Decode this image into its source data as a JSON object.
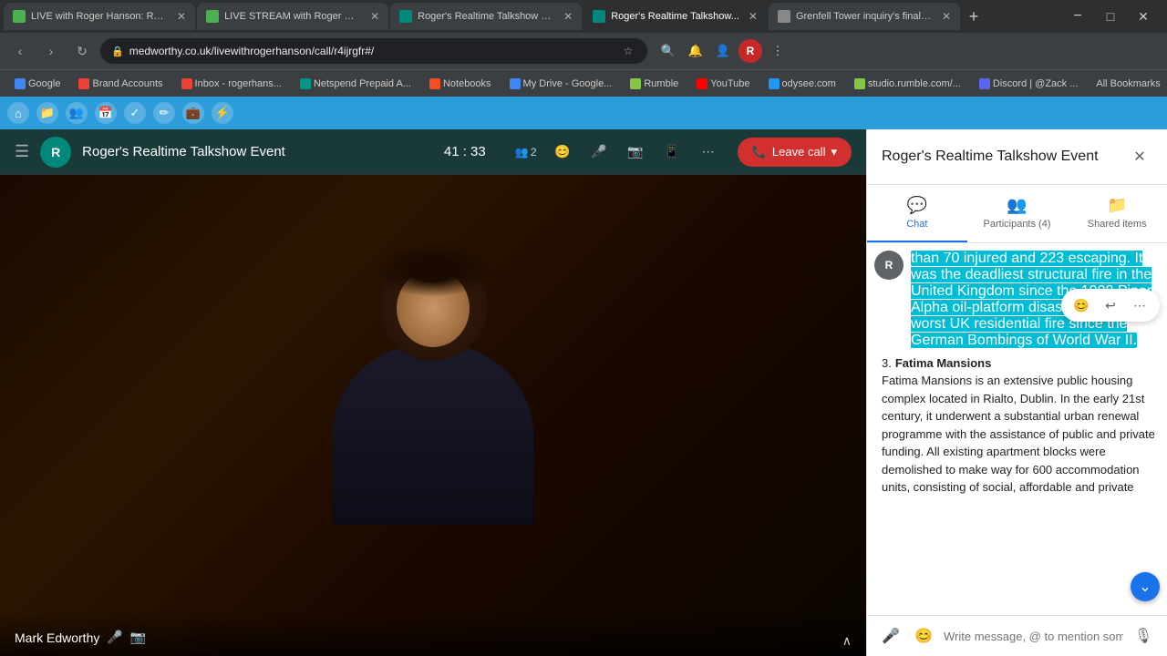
{
  "browser": {
    "tabs": [
      {
        "label": "LIVE with Roger Hanson: Roge...",
        "active": false,
        "favicon": "live"
      },
      {
        "label": "LIVE STREAM with Roger Hans...",
        "active": false,
        "favicon": "live"
      },
      {
        "label": "Roger's Realtime Talkshow Eve...",
        "active": false,
        "favicon": "meet"
      },
      {
        "label": "Roger's Realtime Talkshow...",
        "active": true,
        "favicon": "meet"
      },
      {
        "label": "Grenfell Tower inquiry's final re...",
        "active": false,
        "favicon": "news"
      }
    ],
    "address": "medworthy.co.uk/livewithrogerhanson/call/r4ijrgfr#/",
    "bookmarks": [
      {
        "label": "Google",
        "color": "bm-g"
      },
      {
        "label": "Brand Accounts",
        "color": "bm-gmail"
      },
      {
        "label": "Inbox - rogerhans...",
        "color": "bm-gmail"
      },
      {
        "label": "Netspend Prepaid A...",
        "color": "bm-np"
      },
      {
        "label": "Notebooks",
        "color": "bm-ms"
      },
      {
        "label": "My Drive - Google...",
        "color": "bm-g"
      },
      {
        "label": "Rumble",
        "color": "bm-rumble"
      },
      {
        "label": "YouTube",
        "color": "bm-yt"
      },
      {
        "label": "odysee.com",
        "color": "bm-od"
      },
      {
        "label": "studio.rumble.com/...",
        "color": "bm-rumble"
      },
      {
        "label": "Discord | @Zack ...",
        "color": "bm-dc"
      },
      {
        "label": "All Bookmarks",
        "color": "bm-g"
      }
    ]
  },
  "call": {
    "title": "Roger's Realtime Talkshow Event",
    "timer": "41 : 33",
    "participants_count": "2",
    "video_name": "Mark Edworthy",
    "leave_btn": "Leave call"
  },
  "panel": {
    "title": "Roger's Realtime Talkshow Event",
    "close_icon": "✕",
    "tabs": [
      {
        "label": "Chat",
        "icon": "💬",
        "active": true
      },
      {
        "label": "Participants (4)",
        "icon": "👥",
        "active": false
      },
      {
        "label": "Shared items",
        "icon": "📁",
        "active": false
      }
    ],
    "chat": {
      "messages": [
        {
          "avatar": "R",
          "highlighted": true,
          "text": "than 70 injured and 223 escaping. It was the deadliest structural fire in the United Kingdom since the 1988 Piper Alpha oil-platform disaster and the worst UK residential fire since the German Bombings of World War II."
        }
      ],
      "list_items": [
        {
          "num": "3.",
          "title": "Fatima Mansions",
          "desc": "Fatima Mansions is an extensive public housing complex located in Rialto, Dublin. In the early 21st century, it underwent a substantial urban renewal programme with the assistance of public and private funding. All existing apartment blocks were demolished to make way for 600 accommodation units, consisting of social, affordable and private"
        }
      ],
      "input_placeholder": "Write message, @ to mention someone...",
      "scroll_down_icon": "⌄"
    }
  }
}
